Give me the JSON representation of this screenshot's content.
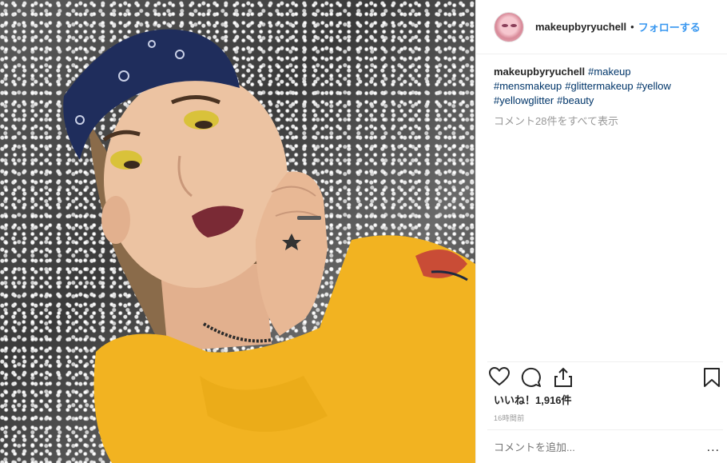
{
  "header": {
    "username": "makeupbyryuchell",
    "separator": "•",
    "follow_label": "フォローする"
  },
  "caption": {
    "username": "makeupbyryuchell",
    "hashtags": [
      "#makeup",
      "#mensmakeup",
      "#glittermakeup",
      "#yellow",
      "#yellowglitter",
      "#beauty"
    ]
  },
  "comments": {
    "view_all_label": "コメント28件をすべて表示"
  },
  "actions": {
    "icons": [
      "heart-icon",
      "comment-icon",
      "share-icon",
      "bookmark-icon"
    ]
  },
  "likes": {
    "label": "いいね！1,916件"
  },
  "timestamp": "16時間前",
  "comment_box": {
    "placeholder": "コメントを追加...",
    "more_label": "..."
  },
  "colors": {
    "link": "#3897f0",
    "hashtag": "#003569",
    "muted": "#999999",
    "shirt": "#f2b321",
    "bandana": "#1f2d5c"
  }
}
